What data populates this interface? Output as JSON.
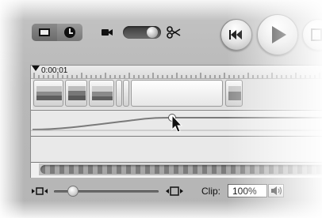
{
  "toolbar": {
    "view_switch": {
      "left_icon": "clip-view-icon",
      "right_icon": "clock-icon",
      "active": "time"
    },
    "mode_switch": {
      "left_icon": "camera-icon",
      "right_icon": "scissors-icon",
      "state": "edit"
    },
    "transport": {
      "rewind_icon": "rewind-icon",
      "play_icon": "play-icon",
      "fullscreen_icon": "fullscreen-play-icon"
    }
  },
  "timeline": {
    "playhead_time": "0:00:01",
    "video_clips": [
      {
        "name": "clip-1",
        "thumb": "landscape"
      },
      {
        "name": "clip-2",
        "thumb": "landscape"
      },
      {
        "name": "clip-3",
        "thumb": "landscape"
      },
      {
        "name": "transition-1"
      },
      {
        "name": "clip-4",
        "thumb": "white"
      },
      {
        "name": "clip-5",
        "thumb": "landscape"
      }
    ],
    "audio_tracks": [
      {
        "name": "audio-track-1",
        "volume_curve": "rising"
      },
      {
        "name": "audio-track-2"
      }
    ]
  },
  "bottom_bar": {
    "zoom_out_icon": "zoom-out-icon",
    "zoom_in_icon": "zoom-in-icon",
    "zoom_level": 0.18,
    "clip_label": "Clip:",
    "clip_volume": "100%",
    "speaker_icon": "speaker-icon"
  },
  "colors": {
    "background": "#bdbdbd",
    "track": "#e9e9e9",
    "curve": "#777777"
  }
}
